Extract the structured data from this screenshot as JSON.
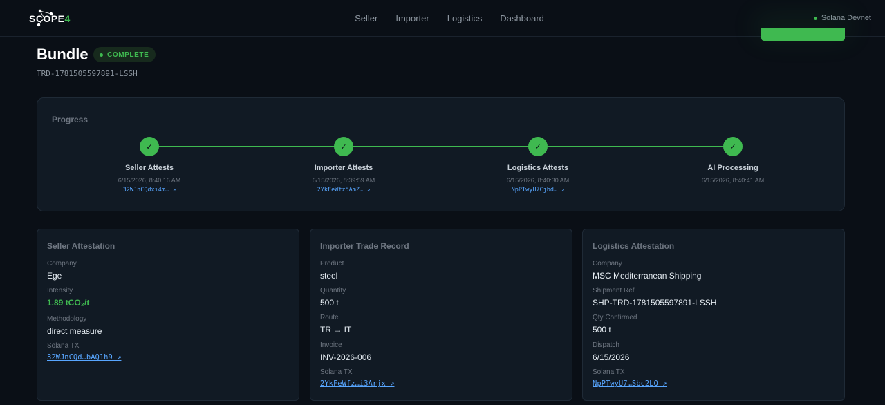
{
  "header": {
    "logo_text": "SCOPE",
    "logo_accent": "4",
    "nav": [
      "Seller",
      "Importer",
      "Logistics",
      "Dashboard"
    ],
    "network": "Solana Devnet"
  },
  "bundle": {
    "title": "Bundle",
    "status": "COMPLETE",
    "trade_id": "TRD-1781505597891-LSSH"
  },
  "progress": {
    "label": "Progress",
    "steps": [
      {
        "name": "Seller Attests",
        "time": "6/15/2026, 8:40:16 AM",
        "tx": "32WJnCQdxi4m… ↗",
        "check": "✓"
      },
      {
        "name": "Importer Attests",
        "time": "6/15/2026, 8:39:59 AM",
        "tx": "2YkFeWfz5AmZ… ↗",
        "check": "✓"
      },
      {
        "name": "Logistics Attests",
        "time": "6/15/2026, 8:40:30 AM",
        "tx": "NpPTwyU7Cjbd… ↗",
        "check": "✓"
      },
      {
        "name": "AI Processing",
        "time": "6/15/2026, 8:40:41 AM",
        "tx": "",
        "check": "✓"
      }
    ]
  },
  "seller": {
    "title": "Seller Attestation",
    "company_label": "Company",
    "company": "Ege",
    "intensity_label": "Intensity",
    "intensity": "1.89 tCO₂/t",
    "methodology_label": "Methodology",
    "methodology": "direct measure",
    "tx_label": "Solana TX",
    "tx": "32WJnCQd…bAQ1h9 ↗"
  },
  "importer": {
    "title": "Importer Trade Record",
    "product_label": "Product",
    "product": "steel",
    "quantity_label": "Quantity",
    "quantity": "500 t",
    "route_label": "Route",
    "route": "TR → IT",
    "invoice_label": "Invoice",
    "invoice": "INV-2026-006",
    "tx_label": "Solana TX",
    "tx": "2YkFeWfz…i3Arjx ↗"
  },
  "logistics": {
    "title": "Logistics Attestation",
    "company_label": "Company",
    "company": "MSC Mediterranean Shipping",
    "shipment_label": "Shipment Ref",
    "shipment": "SHP-TRD-1781505597891-LSSH",
    "qty_label": "Qty Confirmed",
    "qty": "500 t",
    "dispatch_label": "Dispatch",
    "dispatch": "6/15/2026",
    "tx_label": "Solana TX",
    "tx": "NpPTwyU7…Sbc2LQ ↗"
  },
  "colors": {
    "accent": "#3fb950",
    "link": "#58a6ff",
    "background": "#0a0f16",
    "card": "#111a24"
  }
}
